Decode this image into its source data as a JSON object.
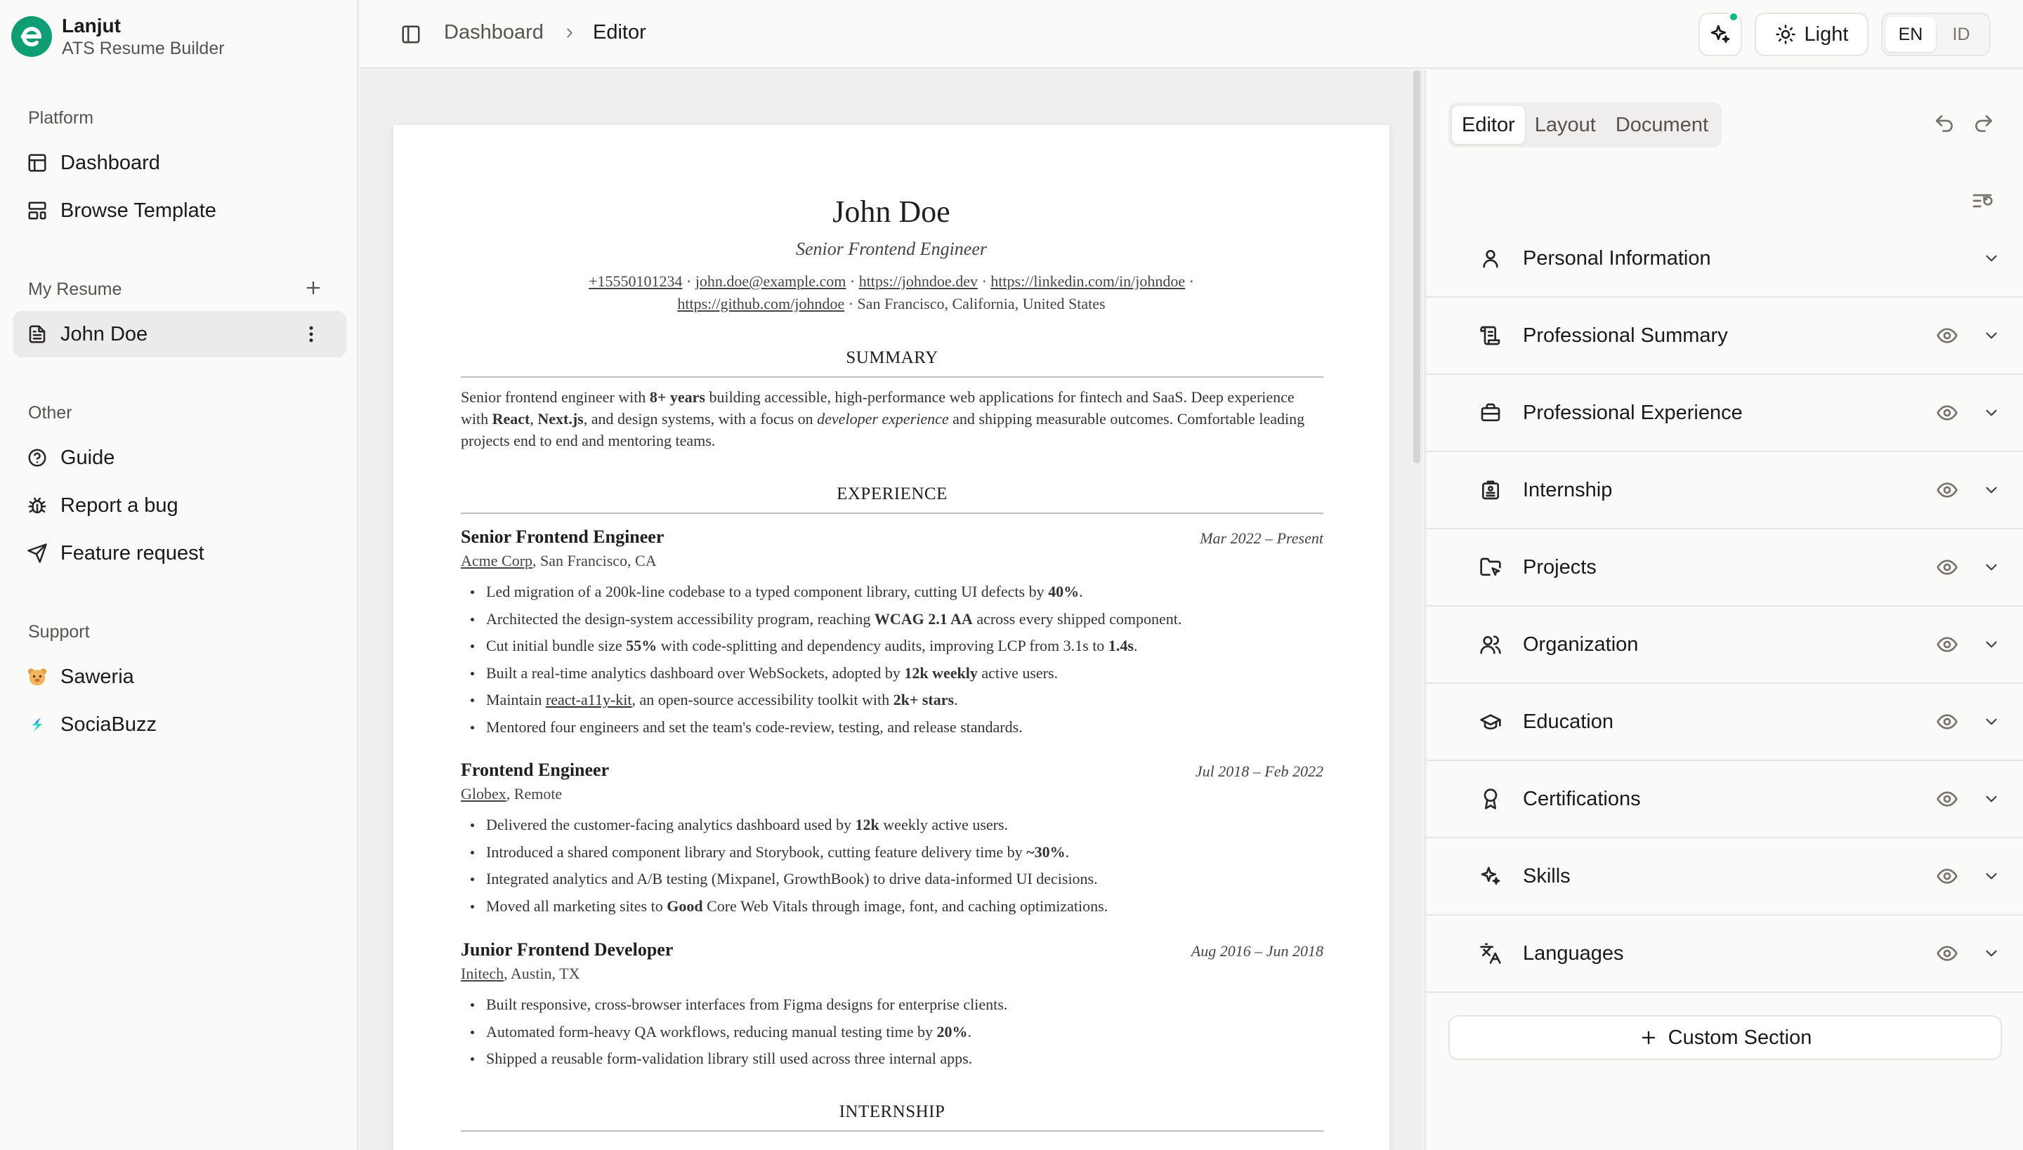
{
  "brand": {
    "name": "Lanjut",
    "subtitle": "ATS Resume Builder"
  },
  "sidebar": {
    "platform_label": "Platform",
    "platform_items": [
      {
        "label": "Dashboard",
        "icon": "layout-dashboard-icon"
      },
      {
        "label": "Browse Template",
        "icon": "layout-template-icon"
      }
    ],
    "my_resume_label": "My Resume",
    "resumes": [
      {
        "label": "John Doe",
        "icon": "file-text-icon",
        "active": true
      }
    ],
    "other_label": "Other",
    "other_items": [
      {
        "label": "Guide",
        "icon": "help-circle-icon"
      },
      {
        "label": "Report a bug",
        "icon": "bug-icon"
      },
      {
        "label": "Feature request",
        "icon": "send-icon"
      }
    ],
    "support_label": "Support",
    "support_items": [
      {
        "label": "Saweria",
        "icon": "saweria-logo"
      },
      {
        "label": "SociaBuzz",
        "icon": "sociabuzz-logo"
      }
    ]
  },
  "header": {
    "breadcrumb": [
      "Dashboard",
      "Editor"
    ],
    "theme_label": "Light",
    "languages": [
      "EN",
      "ID"
    ],
    "active_language": "EN"
  },
  "resume": {
    "name": "John Doe",
    "title": "Senior Frontend Engineer",
    "contact": {
      "phone": "+15550101234",
      "email": "john.doe@example.com",
      "website": "https://johndoe.dev",
      "linkedin": "https://linkedin.com/in/johndoe",
      "github": "https://github.com/johndoe",
      "location": "San Francisco, California, United States"
    },
    "summary_heading": "SUMMARY",
    "summary": {
      "p1": "Senior frontend engineer with ",
      "b1": "8+ years",
      "p2": " building accessible, high-performance web applications for fintech and SaaS. Deep experience with ",
      "b2": "React",
      "p3": ", ",
      "b3": "Next.js",
      "p4": ", and design systems, with a focus on ",
      "i1": "developer experience",
      "p5": " and shipping measurable outcomes. Comfortable leading projects end to end and mentoring teams."
    },
    "experience_heading": "EXPERIENCE",
    "jobs": [
      {
        "title": "Senior Frontend Engineer",
        "date": "Mar 2022 – Present",
        "company": "Acme Corp",
        "location": ", San Francisco, CA",
        "bullets": [
          {
            "a": "Led migration of a 200k-line codebase to a typed component library, cutting UI defects by ",
            "b": "40%",
            "c": "."
          },
          {
            "a": "Architected the design-system accessibility program, reaching ",
            "b": "WCAG 2.1 AA",
            "c": " across every shipped component."
          },
          {
            "a": "Cut initial bundle size ",
            "b": "55%",
            "c": " with code-splitting and dependency audits, improving LCP from 3.1s to ",
            "d": "1.4s",
            "e": "."
          },
          {
            "a": "Built a real-time analytics dashboard over WebSockets, adopted by ",
            "b": "12k weekly",
            "c": " active users."
          },
          {
            "a": "Maintain ",
            "u": "react-a11y-kit",
            "c": ", an open-source accessibility toolkit with ",
            "d": "2k+ stars",
            "e": "."
          },
          {
            "a": "Mentored four engineers and set the team's code-review, testing, and release standards."
          }
        ]
      },
      {
        "title": "Frontend Engineer",
        "date": "Jul 2018 – Feb 2022",
        "company": "Globex",
        "location": ", Remote",
        "bullets": [
          {
            "a": "Delivered the customer-facing analytics dashboard used by ",
            "b": "12k",
            "c": " weekly active users."
          },
          {
            "a": "Introduced a shared component library and Storybook, cutting feature delivery time by ",
            "b": "~30%",
            "c": "."
          },
          {
            "a": "Integrated analytics and A/B testing (Mixpanel, GrowthBook) to drive data-informed UI decisions."
          },
          {
            "a": "Moved all marketing sites to ",
            "b": "Good",
            "c": " Core Web Vitals through image, font, and caching optimizations."
          }
        ]
      },
      {
        "title": "Junior Frontend Developer",
        "date": "Aug 2016 – Jun 2018",
        "company": "Initech",
        "location": ", Austin, TX",
        "bullets": [
          {
            "a": "Built responsive, cross-browser interfaces from Figma designs for enterprise clients."
          },
          {
            "a": "Automated form-heavy QA workflows, reducing manual testing time by ",
            "b": "20%",
            "c": "."
          },
          {
            "a": "Shipped a reusable form-validation library still used across three internal apps."
          }
        ]
      }
    ],
    "internship_heading": "INTERNSHIP"
  },
  "panel": {
    "tabs": [
      "Editor",
      "Layout",
      "Document"
    ],
    "active_tab": "Editor",
    "sections": [
      {
        "label": "Personal Information",
        "icon": "user-icon",
        "visibility_toggle": false
      },
      {
        "label": "Professional Summary",
        "icon": "scroll-icon",
        "visibility_toggle": true
      },
      {
        "label": "Professional Experience",
        "icon": "briefcase-icon",
        "visibility_toggle": true
      },
      {
        "label": "Internship",
        "icon": "badge-id-icon",
        "visibility_toggle": true
      },
      {
        "label": "Projects",
        "icon": "folder-pointer-icon",
        "visibility_toggle": true
      },
      {
        "label": "Organization",
        "icon": "users-icon",
        "visibility_toggle": true
      },
      {
        "label": "Education",
        "icon": "graduation-cap-icon",
        "visibility_toggle": true
      },
      {
        "label": "Certifications",
        "icon": "award-icon",
        "visibility_toggle": true
      },
      {
        "label": "Skills",
        "icon": "sparkles-icon",
        "visibility_toggle": true
      },
      {
        "label": "Languages",
        "icon": "languages-icon",
        "visibility_toggle": true
      }
    ],
    "custom_section_label": "Custom Section"
  },
  "colors": {
    "brand": "#0f9d76",
    "notification_dot": "#10b981"
  }
}
